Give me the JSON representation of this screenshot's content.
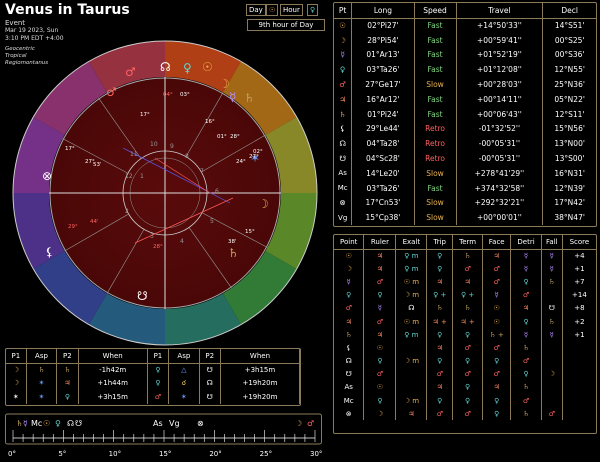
{
  "header": {
    "title": "Venus in Taurus",
    "subtitle": "Event",
    "date": "Mar 19 2023, Sun",
    "time": "3:10 PM EDT +4:00",
    "system": [
      "Geocentric",
      "Tropical",
      "Regiomontanus"
    ]
  },
  "day_hour": {
    "day_label": "Day",
    "day_ruler": "☉",
    "hour_label": "Hour",
    "hour_ruler": "♀",
    "hour_text": "9th hour of Day"
  },
  "colors": {
    "sun": "#e8b04c",
    "moon": "#e8b04c",
    "mercury": "#b68cff",
    "venus": "#5fd3d0",
    "mars": "#ff6464",
    "jupiter": "#ff8c66",
    "saturn": "#c0a060",
    "fast": "#7fd67f",
    "slow": "#e8b04c",
    "retro": "#ff6060",
    "border": "#8a7a5a"
  },
  "planets": {
    "headers": [
      "Pt",
      "Long",
      "Speed",
      "Travel",
      "Decl"
    ],
    "rows": [
      {
        "pt": "☉",
        "color": "#e8b04c",
        "long": "02°Pi27'",
        "speed": "Fast",
        "cls": "fast",
        "travel": "+14°50'33''",
        "decl": "14°S51'"
      },
      {
        "pt": "☽",
        "color": "#e8b04c",
        "long": "28°Pi54'",
        "speed": "Fast",
        "cls": "fast",
        "travel": "+00°59'41''",
        "decl": "00°S25'"
      },
      {
        "pt": "☿",
        "color": "#b68cff",
        "long": "01°Ar13'",
        "speed": "Fast",
        "cls": "fast",
        "travel": "+01°52'19''",
        "decl": "00°S36'"
      },
      {
        "pt": "♀",
        "color": "#5fd3d0",
        "long": "03°Ta26'",
        "speed": "Fast",
        "cls": "fast",
        "travel": "+01°12'08''",
        "decl": "12°N55'"
      },
      {
        "pt": "♂",
        "color": "#ff6464",
        "long": "27°Ge17'",
        "speed": "Slow",
        "cls": "slow",
        "travel": "+00°28'03''",
        "decl": "25°N36'"
      },
      {
        "pt": "♃",
        "color": "#ff8c66",
        "long": "16°Ar12'",
        "speed": "Fast",
        "cls": "fast",
        "travel": "+00°14'11''",
        "decl": "05°N22'"
      },
      {
        "pt": "♄",
        "color": "#c0a060",
        "long": "01°Pi24'",
        "speed": "Fast",
        "cls": "fast",
        "travel": "+00°06'43''",
        "decl": "12°S11'"
      },
      {
        "pt": "⚸",
        "color": "#ffffff",
        "long": "29°Le44'",
        "speed": "Retro",
        "cls": "retro",
        "travel": "-01°32'52''",
        "decl": "15°N56'"
      },
      {
        "pt": "☊",
        "color": "#ffffff",
        "long": "04°Ta28'",
        "speed": "Retro",
        "cls": "retro",
        "travel": "-00°05'31''",
        "decl": "13°N00'"
      },
      {
        "pt": "☋",
        "color": "#ffffff",
        "long": "04°Sc28'",
        "speed": "Retro",
        "cls": "retro",
        "travel": "-00°05'31''",
        "decl": "13°S00'"
      },
      {
        "pt": "As",
        "color": "#ffffff",
        "long": "14°Le20'",
        "speed": "Slow",
        "cls": "slow",
        "travel": "+278°41'29''",
        "decl": "16°N31'"
      },
      {
        "pt": "Mc",
        "color": "#ffffff",
        "long": "03°Ta26'",
        "speed": "Fast",
        "cls": "fast",
        "travel": "+374°32'58''",
        "decl": "12°N39'"
      },
      {
        "pt": "⊗",
        "color": "#ffffff",
        "long": "17°Cn53'",
        "speed": "Slow",
        "cls": "slow",
        "travel": "+292°32'21''",
        "decl": "17°N42'"
      },
      {
        "pt": "Vg",
        "color": "#ffffff",
        "long": "15°Cp38'",
        "speed": "Slow",
        "cls": "slow",
        "travel": "+00°00'01''",
        "decl": "38°N47'"
      }
    ]
  },
  "dignities": {
    "headers": [
      "Point",
      "Ruler",
      "Exalt",
      "Trip",
      "Term",
      "Face",
      "Detri",
      "Fall",
      "Score"
    ],
    "rows": [
      [
        "☉",
        "♃",
        "♀ m",
        "♀",
        "♄",
        "♃",
        "☿",
        "☿",
        "+4"
      ],
      [
        "☽",
        "♃",
        "♀ m",
        "♀",
        "♂",
        "♂",
        "☿",
        "☿",
        "+1"
      ],
      [
        "☿",
        "♂",
        "☉ m",
        "♃",
        "♃",
        "♂",
        "♀",
        "♄",
        "+7"
      ],
      [
        "♀",
        "♀",
        "☽ m",
        "♀ +",
        "♀ +",
        "☿",
        "♂",
        "",
        "+14"
      ],
      [
        "♂",
        "☿",
        "☊",
        "♄",
        "♄",
        "☉",
        "♃",
        "☋",
        "+8"
      ],
      [
        "♃",
        "♂",
        "☉ m",
        "♃ +",
        "♃ +",
        "☉",
        "♀",
        "♄",
        "+2"
      ],
      [
        "♄",
        "♃",
        "♀ m",
        "♀",
        "♀",
        "♄ +",
        "☿",
        "☿",
        "+1"
      ],
      [
        "⚸",
        "☉",
        "",
        "♃",
        "♂",
        "♂",
        "♄",
        "",
        ""
      ],
      [
        "☊",
        "♀",
        "☽ m",
        "♀",
        "♀",
        "♀",
        "♂",
        "",
        ""
      ],
      [
        "☋",
        "♂",
        "",
        "♂",
        "♂",
        "♂",
        "♀",
        "☽",
        ""
      ],
      [
        "As",
        "☉",
        "",
        "♃",
        "♀",
        "♃",
        "♄",
        "",
        ""
      ],
      [
        "Mc",
        "♀",
        "☽ m",
        "♀",
        "♀",
        "♀",
        "♂",
        "",
        ""
      ],
      [
        "⊗",
        "☽",
        "♃",
        "♂",
        "♂",
        "♀",
        "♄",
        "♂",
        ""
      ]
    ]
  },
  "aspects": {
    "headers": [
      "P1",
      "Asp",
      "P2",
      "When",
      "P1",
      "Asp",
      "P2",
      "When"
    ],
    "rows": [
      [
        "☽",
        "♄",
        "♄",
        "-1h42m",
        "♀",
        "△",
        "☋",
        "+3h15m"
      ],
      [
        "☽",
        "✶",
        "♃",
        "+1h44m",
        "♀",
        "☌",
        "☊",
        "+19h20m"
      ],
      [
        "✶",
        "✶",
        "♀",
        "+3h15m",
        "♂",
        "✶",
        "☋",
        "+19h20m"
      ]
    ]
  },
  "ruler": {
    "ticks": [
      "0°",
      "5°",
      "10°",
      "15°",
      "20°",
      "25°",
      "30°"
    ],
    "markers": [
      "♄",
      "☿",
      "Mc",
      "☉",
      "♀",
      "☊",
      "☋",
      "As",
      "Vg",
      "⊗",
      "☽",
      "♂"
    ]
  },
  "wheel": {
    "house_numbers": [
      "1",
      "2",
      "3",
      "4",
      "5",
      "6",
      "7",
      "8",
      "9",
      "10",
      "11",
      "12"
    ],
    "degree_labels": [
      "17°",
      "27°",
      "53'",
      "29°",
      "44'",
      "04°",
      "03°",
      "16°",
      "01°",
      "28°",
      "02°",
      "27°",
      "24°",
      "15°",
      "38'",
      "28°",
      "17°"
    ]
  }
}
